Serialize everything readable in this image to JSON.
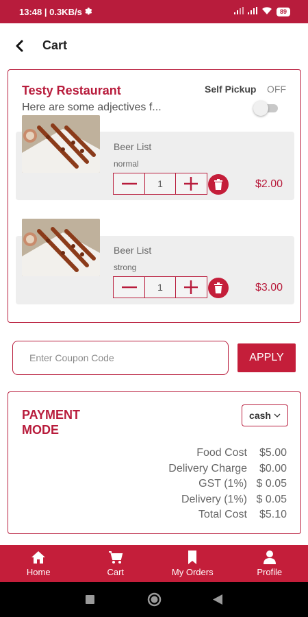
{
  "status_bar": {
    "time_speed": "13:48 | 0.3KB/s",
    "battery": "89"
  },
  "header": {
    "title": "Cart"
  },
  "restaurant": {
    "name": "Testy Restaurant",
    "description": "Here are some adjectives f...",
    "pickup_label": "Self Pickup",
    "pickup_state": "OFF"
  },
  "cart_items": [
    {
      "name": "Beer List",
      "variant": "normal",
      "quantity": "1",
      "price": "$2.00"
    },
    {
      "name": "Beer List",
      "variant": "strong",
      "quantity": "1",
      "price": "$3.00"
    }
  ],
  "coupon": {
    "placeholder": "Enter Coupon Code",
    "apply_label": "APPLY"
  },
  "payment": {
    "title": "PAYMENT MODE",
    "selected_mode": "cash",
    "costs": [
      {
        "label": "Food Cost",
        "value": "$5.00"
      },
      {
        "label": "Delivery Charge",
        "value": "$0.00"
      },
      {
        "label": "GST (1%)",
        "value": "$ 0.05"
      },
      {
        "label": "Delivery (1%)",
        "value": "$ 0.05"
      },
      {
        "label": "Total Cost",
        "value": "$5.10"
      }
    ]
  },
  "bottom_nav": {
    "home": "Home",
    "cart": "Cart",
    "orders": "My Orders",
    "profile": "Profile"
  },
  "colors": {
    "primary": "#c41e3a",
    "status_bar": "#b81c3c"
  }
}
